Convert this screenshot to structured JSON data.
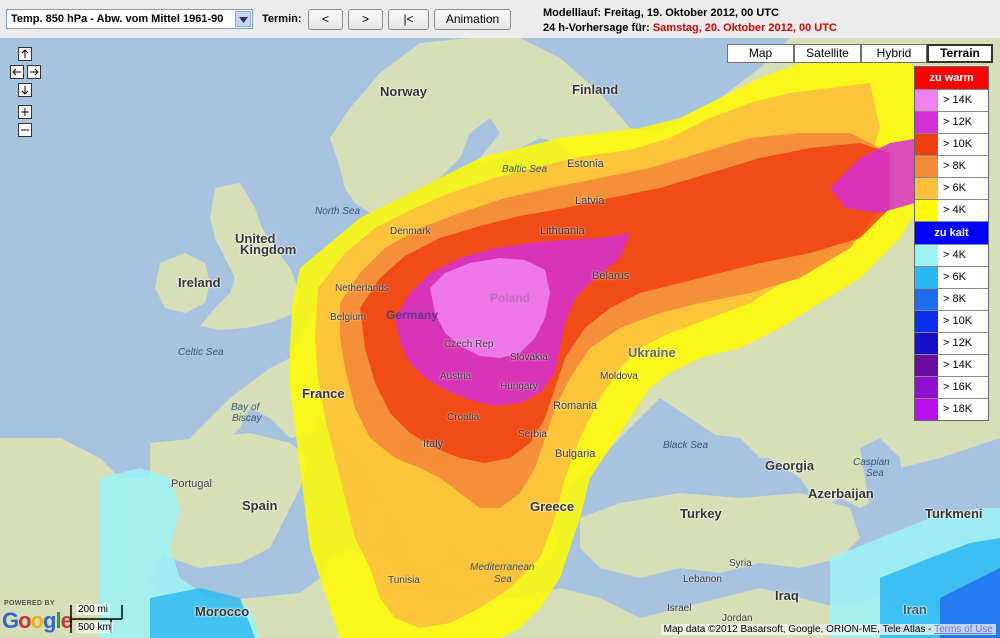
{
  "toolbar": {
    "parameter_selected": "Temp. 850 hPa - Abw. vom Mittel 1961-90",
    "termin_label": "Termin:",
    "btn_prev": "<",
    "btn_next": ">",
    "btn_first": "|<",
    "btn_animation": "Animation",
    "modelllauf": "Modelllauf: Freitag, 19. Oktober 2012, 00 UTC",
    "vorhersage_prefix": "24 h-Vorhersage für:",
    "vorhersage_date": "Samstag, 20. Oktober 2012, 00 UTC"
  },
  "map_types": [
    "Map",
    "Satellite",
    "Hybrid",
    "Terrain"
  ],
  "map_type_active": "Terrain",
  "legend": {
    "warm_title": "zu warm",
    "warm_color": "#ff0000",
    "warm": [
      {
        "label": "> 14K",
        "color": "#f080f0"
      },
      {
        "label": "> 12K",
        "color": "#d530d5"
      },
      {
        "label": "> 10K",
        "color": "#f04010"
      },
      {
        "label": "> 8K",
        "color": "#f5883a"
      },
      {
        "label": "> 6K",
        "color": "#fdbf3d"
      },
      {
        "label": "> 4K",
        "color": "#fffb00"
      }
    ],
    "cold_title": "zu kalt",
    "cold_color": "#0000ff",
    "cold": [
      {
        "label": "> 4K",
        "color": "#9ef3f6"
      },
      {
        "label": "> 6K",
        "color": "#2ab8f2"
      },
      {
        "label": "> 8K",
        "color": "#1e6df0"
      },
      {
        "label": "> 10K",
        "color": "#0a30ee"
      },
      {
        "label": "> 12K",
        "color": "#1410cc"
      },
      {
        "label": "> 14K",
        "color": "#6a0ea0"
      },
      {
        "label": "> 16K",
        "color": "#9010d0"
      },
      {
        "label": "> 18K",
        "color": "#bb10ee"
      }
    ]
  },
  "labels": {
    "norway": "Norway",
    "finland": "Finland",
    "estonia": "Estonia",
    "latvia": "Latvia",
    "lithuania": "Lithuania",
    "denmark": "Denmark",
    "united_kingdom_1": "United",
    "united_kingdom_2": "Kingdom",
    "ireland": "Ireland",
    "netherlands": "Netherlands",
    "belgium": "Belgium",
    "germany": "Germany",
    "poland": "Poland",
    "belarus": "Belarus",
    "czech": "Czech Rep",
    "slovakia": "Slovakia",
    "austria": "Austria",
    "hungary": "Hungary",
    "ukraine": "Ukraine",
    "moldova": "Moldova",
    "romania": "Romania",
    "france": "France",
    "croatia": "Croatia",
    "serbia": "Serbia",
    "italy": "Italy",
    "bulgaria": "Bulgaria",
    "portugal": "Portugal",
    "spain": "Spain",
    "greece": "Greece",
    "turkey": "Turkey",
    "georgia": "Georgia",
    "azerbaijan": "Azerbaijan",
    "turkmenistan": "Turkmeni",
    "tunisia": "Tunisia",
    "morocco": "Morocco",
    "syria": "Syria",
    "lebanon": "Lebanon",
    "iraq": "Iraq",
    "iran": "Iran",
    "israel": "Israel",
    "jordan": "Jordan",
    "north_sea": "North Sea",
    "baltic_sea": "Baltic Sea",
    "celtic_sea": "Celtic Sea",
    "bay_of_biscay_1": "Bay of",
    "bay_of_biscay_2": "Biscay",
    "black_sea": "Black Sea",
    "caspian_1": "Caspian",
    "caspian_2": "Sea",
    "mediterranean_1": "Mediterranean",
    "mediterranean_2": "Sea"
  },
  "footer": {
    "powered_by": "POWERED BY",
    "scale_top": "200 mi",
    "scale_bottom": "500 km",
    "attribution": "Map data ©2012 Basarsoft, Google, ORION-ME, Tele Atlas - ",
    "terms": "Terms of Use"
  }
}
